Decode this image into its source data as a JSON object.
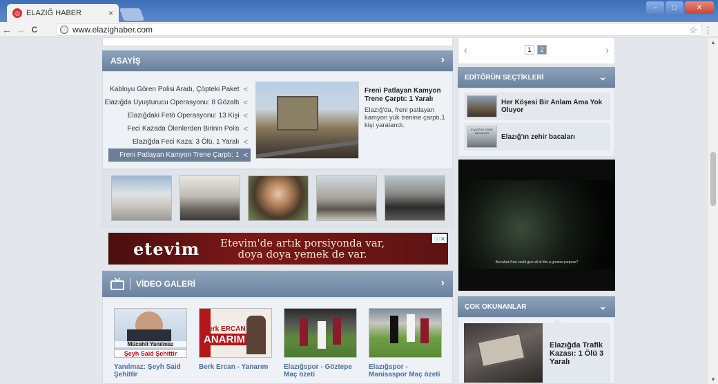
{
  "browser": {
    "tab_title": "ELAZIĞ HABER",
    "tab_close": "×",
    "favicon": "◎",
    "url": "www.elazighaber.com",
    "nav": {
      "back": "←",
      "forward": "→",
      "reload": "C",
      "info": "ⓘ",
      "star": "☆",
      "menu": "⋮"
    }
  },
  "asayis": {
    "title": "ASAYİŞ",
    "arrow": "›",
    "items": [
      "Kabloyu Gören Polisi Aradı, Çöpteki Paket",
      "Elazığda Uyuşturucu Operasyonu: 8 Gözaltı",
      "Elazığdaki Fetö Operasyonu: 13 Kişi",
      "Feci Kazada Ölenlerden Birinin Polis",
      "Elazığda Feci Kaza: 3 Ölü, 1 Yaralı",
      "Freni Patlayan Kamyon Trene Çarptı: 1"
    ],
    "chev": "<",
    "main_title": "Freni Patlayan Kamyon Trene Çarptı: 1 Yaralı",
    "main_desc": "Elazığ'da, freni patlayan kamyon yük trenine çarptı,1 kişi yaralandı."
  },
  "ad": {
    "brand": "etevim",
    "tagline_1": "Etevim'de artık porsiyonda var,",
    "tagline_2": "doya doya yemek de var.",
    "badge": "ⓘ✕"
  },
  "video_galeri": {
    "title": "VİDEO GALERİ",
    "arrow": "›",
    "items": [
      {
        "caption": "Yanılmaz: Şeyh Said Şehittir",
        "overlay_1": "Mücahit Yanılmaz",
        "overlay_2": "Şeyh Said Şehittir"
      },
      {
        "caption": "Berk Ercan - Yanarım",
        "overlay_1": "Berk ERCAN",
        "overlay_2": "ANARIM"
      },
      {
        "caption": "Elazığspor - Göztepe Maç özeti"
      },
      {
        "caption": "Elazığspor - Manisaspor Maç özeti"
      }
    ]
  },
  "pager": {
    "prev": "‹",
    "next": "›",
    "pages": [
      "1",
      "2"
    ],
    "active": "2"
  },
  "editorun": {
    "title": "EDİTÖRÜN SEÇTİKLERİ",
    "chevron": "⌄",
    "items": [
      "Her Köşesi Bir Anlam Ama Yok Oluyor",
      "Elazığ'ın zehir bacaları"
    ],
    "thumb_text": "ELAZIĞ'IN ZEHİR BACALARI"
  },
  "video_player": {
    "subtitle": "But what if we could give all of this a greater purpose?"
  },
  "cok_okunanlar": {
    "title": "ÇOK OKUNANLAR",
    "chevron": "⌄",
    "item_title": "Elazığda Trafik Kazası: 1 Ölü 3 Yaralı"
  },
  "colors": {
    "section_header": "#7a90ab",
    "accent_link": "#4a6fa5",
    "active_item": "#6b7f98"
  }
}
